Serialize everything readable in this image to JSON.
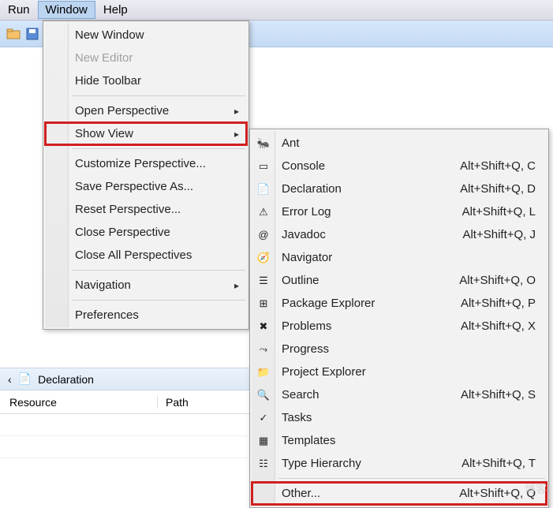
{
  "menubar": {
    "run": "Run",
    "window": "Window",
    "help": "Help"
  },
  "dropdown": {
    "new_window": "New Window",
    "new_editor": "New Editor",
    "hide_toolbar": "Hide Toolbar",
    "open_perspective": "Open Perspective",
    "show_view": "Show View",
    "customize_perspective": "Customize Perspective...",
    "save_perspective_as": "Save Perspective As...",
    "reset_perspective": "Reset Perspective...",
    "close_perspective": "Close Perspective",
    "close_all_perspectives": "Close All Perspectives",
    "navigation": "Navigation",
    "preferences": "Preferences"
  },
  "submenu": {
    "items": [
      {
        "label": "Ant",
        "shortcut": "",
        "icon": "🐜"
      },
      {
        "label": "Console",
        "shortcut": "Alt+Shift+Q, C",
        "icon": "▭"
      },
      {
        "label": "Declaration",
        "shortcut": "Alt+Shift+Q, D",
        "icon": "📄"
      },
      {
        "label": "Error Log",
        "shortcut": "Alt+Shift+Q, L",
        "icon": "⚠"
      },
      {
        "label": "Javadoc",
        "shortcut": "Alt+Shift+Q, J",
        "icon": "@"
      },
      {
        "label": "Navigator",
        "shortcut": "",
        "icon": "🧭"
      },
      {
        "label": "Outline",
        "shortcut": "Alt+Shift+Q, O",
        "icon": "☰"
      },
      {
        "label": "Package Explorer",
        "shortcut": "Alt+Shift+Q, P",
        "icon": "⊞"
      },
      {
        "label": "Problems",
        "shortcut": "Alt+Shift+Q, X",
        "icon": "✖"
      },
      {
        "label": "Progress",
        "shortcut": "",
        "icon": "⤳"
      },
      {
        "label": "Project Explorer",
        "shortcut": "",
        "icon": "📁"
      },
      {
        "label": "Search",
        "shortcut": "Alt+Shift+Q, S",
        "icon": "🔍"
      },
      {
        "label": "Tasks",
        "shortcut": "",
        "icon": "✓"
      },
      {
        "label": "Templates",
        "shortcut": "",
        "icon": "▦"
      },
      {
        "label": "Type Hierarchy",
        "shortcut": "Alt+Shift+Q, T",
        "icon": "☷"
      }
    ],
    "other": {
      "label": "Other...",
      "shortcut": "Alt+Shift+Q, Q"
    }
  },
  "panel": {
    "tab_declaration": "Declaration",
    "col_resource": "Resource",
    "col_path": "Path"
  },
  "watermark": "博客"
}
